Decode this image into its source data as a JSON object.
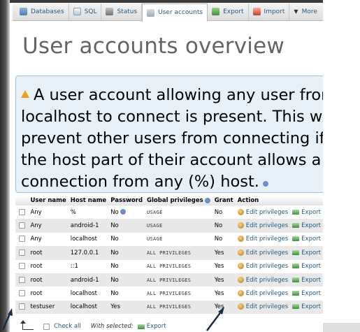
{
  "tabs": [
    {
      "label": "Databases",
      "icon": "database-icon"
    },
    {
      "label": "SQL",
      "icon": "sql-icon"
    },
    {
      "label": "Status",
      "icon": "status-icon"
    },
    {
      "label": "User accounts",
      "icon": "users-icon",
      "active": true
    },
    {
      "label": "Export",
      "icon": "export-icon"
    },
    {
      "label": "Import",
      "icon": "import-icon"
    },
    {
      "label": "More",
      "icon": "chevron-down-icon"
    }
  ],
  "page_title": "User accounts overview",
  "notice": {
    "lines": [
      "A user account allowing any user from",
      "localhost to connect is present. This will",
      "prevent other users from connecting if",
      "the host part of their account allows a",
      "connection from any (%) host."
    ]
  },
  "table": {
    "headers": [
      "User name",
      "Host name",
      "Password",
      "Global privileges",
      "Grant",
      "Action"
    ],
    "edit_label": "Edit privileges",
    "export_label": "Export",
    "rows": [
      {
        "user": "Any",
        "host": "%",
        "password": "No",
        "privileges": "USAGE",
        "grant": "No"
      },
      {
        "user": "Any",
        "host": "android-1",
        "password": "No",
        "privileges": "USAGE",
        "grant": "No"
      },
      {
        "user": "Any",
        "host": "localhost",
        "password": "No",
        "privileges": "USAGE",
        "grant": "No"
      },
      {
        "user": "root",
        "host": "127.0.0.1",
        "password": "No",
        "privileges": "ALL PRIVILEGES",
        "grant": "Yes"
      },
      {
        "user": "root",
        "host": "::1",
        "password": "No",
        "privileges": "ALL PRIVILEGES",
        "grant": "Yes"
      },
      {
        "user": "root",
        "host": "android-1",
        "password": "No",
        "privileges": "ALL PRIVILEGES",
        "grant": "Yes"
      },
      {
        "user": "root",
        "host": "localhost",
        "password": "No",
        "privileges": "ALL PRIVILEGES",
        "grant": "Yes"
      },
      {
        "user": "testuser",
        "host": "localhost",
        "password": "Yes",
        "privileges": "ALL PRIVILEGES",
        "grant": "Yes"
      }
    ]
  },
  "footer": {
    "check_all": "Check all",
    "with_selected": "With selected:",
    "export": "Export"
  },
  "colors": {
    "link": "#235a81",
    "danger": "#d11a1a",
    "notice_bg": "#e8f0f7",
    "title": "#646464"
  }
}
